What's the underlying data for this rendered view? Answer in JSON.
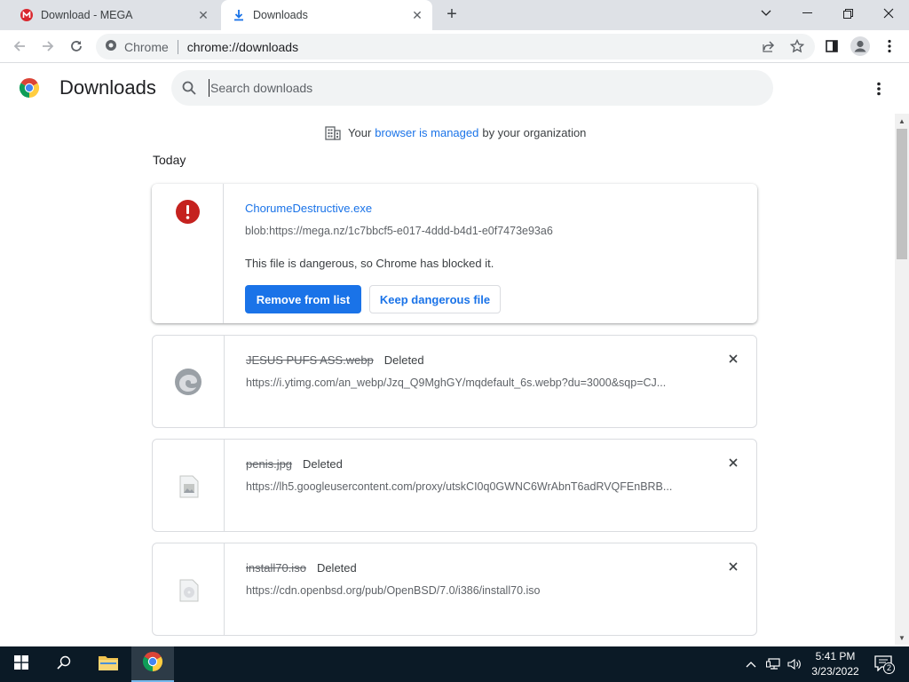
{
  "window": {
    "tabs": [
      {
        "title": "Download - MEGA",
        "favicon": "mega-icon",
        "active": false
      },
      {
        "title": "Downloads",
        "favicon": "download-icon",
        "active": true
      }
    ]
  },
  "toolbar": {
    "site_chip": "Chrome",
    "url": "chrome://downloads"
  },
  "header": {
    "title": "Downloads",
    "search_placeholder": "Search downloads"
  },
  "managed": {
    "prefix": "Your",
    "link": "browser is managed",
    "suffix": "by your organization"
  },
  "section_date": "Today",
  "downloads": [
    {
      "filename": "ChorumeDestructive.exe",
      "url": "blob:https://mega.nz/1c7bbcf5-e017-4ddd-b4d1-e0f7473e93a6",
      "message": "This file is dangerous, so Chrome has blocked it.",
      "primary_button": "Remove from list",
      "secondary_button": "Keep dangerous file",
      "icon": "danger-icon"
    },
    {
      "filename": "JESUS PUFS ASS.webp",
      "status": "Deleted",
      "url": "https://i.ytimg.com/an_webp/Jzq_Q9MghGY/mqdefault_6s.webp?du=3000&sqp=CJ...",
      "icon": "edge-file-icon"
    },
    {
      "filename": "penis.jpg",
      "status": "Deleted",
      "url": "https://lh5.googleusercontent.com/proxy/utskCI0q0GWNC6WrAbnT6adRVQFEnBRB...",
      "icon": "image-file-icon"
    },
    {
      "filename": "install70.iso",
      "status": "Deleted",
      "url": "https://cdn.openbsd.org/pub/OpenBSD/7.0/i386/install70.iso",
      "icon": "disc-file-icon"
    }
  ],
  "taskbar": {
    "time": "5:41 PM",
    "date": "3/23/2022",
    "notification_count": "2"
  },
  "colors": {
    "accent": "#1a73e8",
    "danger": "#d93025",
    "taskbar": "#0b1a26"
  }
}
